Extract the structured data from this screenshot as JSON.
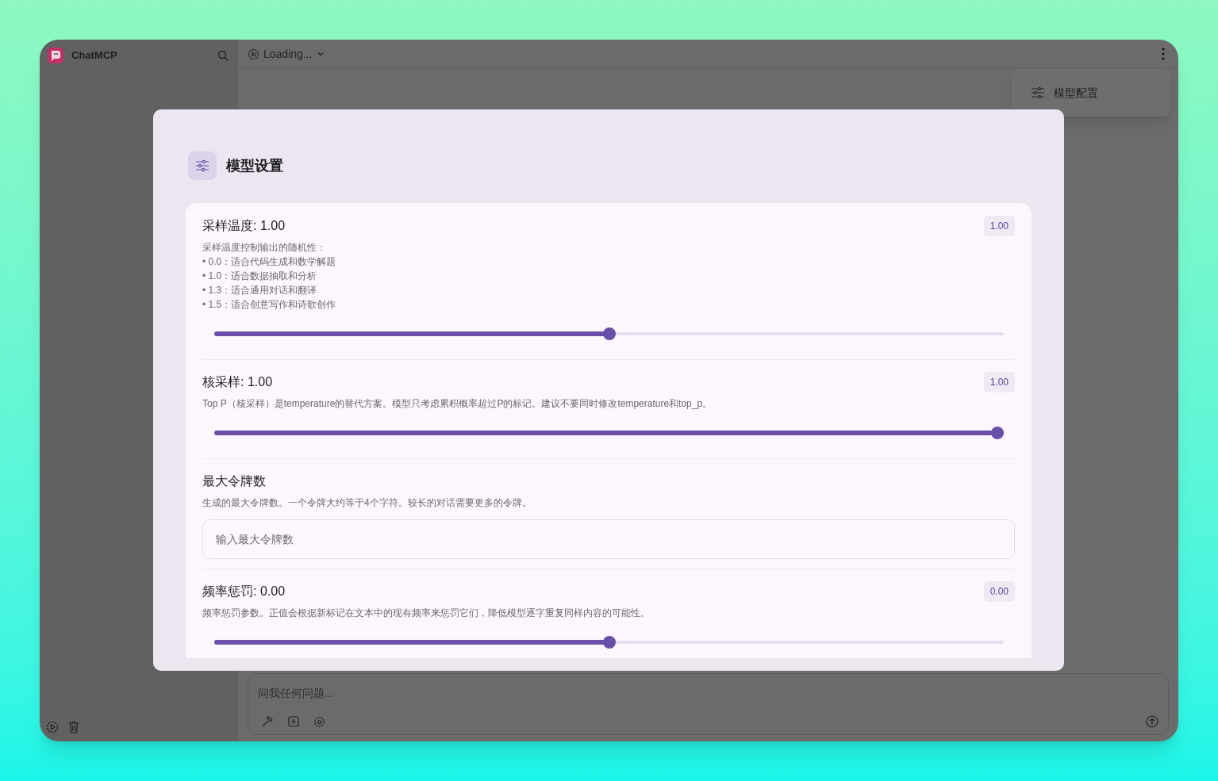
{
  "app": {
    "name": "ChatMCP"
  },
  "model_selector": {
    "label": "Loading..."
  },
  "menu": {
    "items": [
      {
        "label": "模型配置"
      }
    ]
  },
  "modal": {
    "title": "模型设置",
    "settings": [
      {
        "kind": "slider",
        "title": "采样温度: 1.00",
        "badge": "1.00",
        "description": [
          "采样温度控制输出的随机性：",
          "• 0.0：适合代码生成和数学解题",
          "• 1.0：适合数据抽取和分析",
          "• 1.3：适合通用对话和翻译",
          "• 1.5：适合创意写作和诗歌创作"
        ],
        "level": 0.5
      },
      {
        "kind": "slider",
        "title": "核采样: 1.00",
        "badge": "1.00",
        "description": [
          "Top P（核采样）是temperature的替代方案。模型只考虑累积概率超过P的标记。建议不要同时修改temperature和top_p。"
        ],
        "level": 1.0
      },
      {
        "kind": "input",
        "title": "最大令牌数",
        "description": [
          "生成的最大令牌数。一个令牌大约等于4个字符。较长的对话需要更多的令牌。"
        ],
        "placeholder": "输入最大令牌数"
      },
      {
        "kind": "slider",
        "title": "频率惩罚: 0.00",
        "badge": "0.00",
        "description": [
          "频率惩罚参数。正值会根据新标记在文本中的现有频率来惩罚它们，降低模型逐字重复同样内容的可能性。"
        ],
        "level": 0.5
      }
    ]
  },
  "chat_input": {
    "placeholder": "问我任何问题..."
  }
}
